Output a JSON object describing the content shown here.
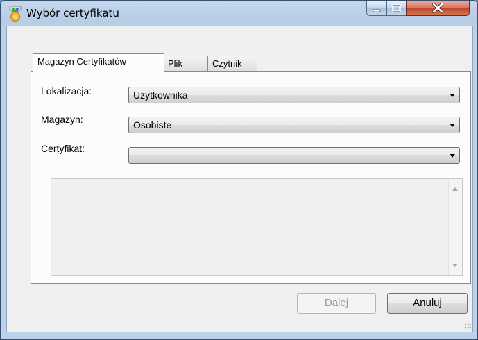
{
  "window": {
    "title": "Wybór certyfikatu",
    "controls": {
      "minimize": "minimize-icon",
      "maximize": "maximize-icon",
      "close": "close-icon"
    }
  },
  "tabs": [
    {
      "label": "Magazyn Certyfikatów",
      "active": true
    },
    {
      "label": "Plik",
      "active": false
    },
    {
      "label": "Czytnik",
      "active": false
    }
  ],
  "form": {
    "location_label": "Lokalizacja:",
    "location_value": "Użytkownika",
    "store_label": "Magazyn:",
    "store_value": "Osobiste",
    "certificate_label": "Certyfikat:",
    "certificate_value": ""
  },
  "buttons": {
    "next_label": "Dalej",
    "next_enabled": false,
    "cancel_label": "Anuluj"
  },
  "colors": {
    "title_bar": "#b6cde6",
    "close_button": "#c0452c",
    "dialog_bg": "#f0f0f0"
  }
}
